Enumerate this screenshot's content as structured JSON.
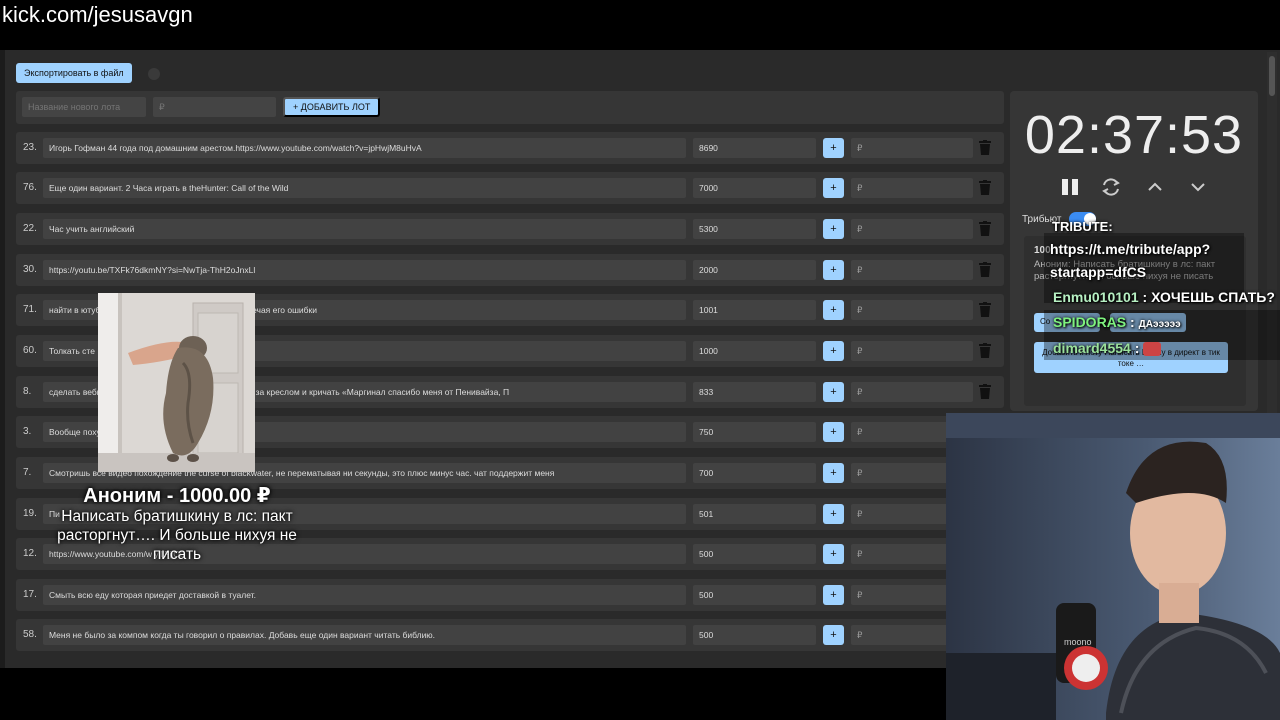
{
  "browser": {
    "url": "kick.com/jesusavgn"
  },
  "toolbar": {
    "export_label": "Экспортировать в файл"
  },
  "add_lot": {
    "name_placeholder": "Название нового лота",
    "amount_placeholder": "₽",
    "add_label": "+ ДОБАВИТЬ ЛОТ"
  },
  "lots": [
    {
      "num": "23.",
      "name": "Игорь Гофман 44 года под домашним арестом.https://www.youtube.com/watch?v=jpHwjM8uHvA",
      "amount": "8690",
      "plus": "+",
      "rub": "₽"
    },
    {
      "num": "76.",
      "name": "Еще один вариант. 2 Часа играть в theHunter: Call of the Wild",
      "amount": "7000",
      "plus": "+",
      "rub": "₽"
    },
    {
      "num": "22.",
      "name": "Час учить английский",
      "amount": "5300",
      "plus": "+",
      "rub": "₽"
    },
    {
      "num": "30.",
      "name": "https://youtu.be/TXFk76dkmNY?si=NwTja-ThH2oJnxLl",
      "amount": "2000",
      "plus": "+",
      "rub": "₽"
    },
    {
      "num": "71.",
      "name": "найти в ютуб                                                               трого в кс и комментировать ее, подмечая его ошибки",
      "amount": "1001",
      "plus": "+",
      "rub": "₽"
    },
    {
      "num": "60.",
      "name": "Толкать сте",
      "amount": "1000",
      "plus": "+",
      "rub": "₽"
    },
    {
      "num": "8.",
      "name": "сделать вебк                                                          ртку Пенивайза. и 60 минут прятаться за креслом и кричать «Маргинал спасибо меня от Пенивайза, П",
      "amount": "833",
      "plus": "+",
      "rub": "₽"
    },
    {
      "num": "3.",
      "name": "Вообще похуй",
      "amount": "750",
      "plus": "+",
      "rub": "₽"
    },
    {
      "num": "7.",
      "name": "Смотришь все видео                                        похождение the curse of blackwater, не перематывая ни секунды, это плюс минус час. чат поддержит меня",
      "amount": "700",
      "plus": "+",
      "rub": "₽"
    },
    {
      "num": "19.",
      "name": "Пи",
      "amount": "501",
      "plus": "+",
      "rub": "₽"
    },
    {
      "num": "12.",
      "name": "https://www.youtube.com/w                                  yillFjjOs",
      "amount": "500",
      "plus": "+",
      "rub": "₽"
    },
    {
      "num": "17.",
      "name": "Смыть всю еду которая приедет доставкой в туалет.",
      "amount": "500",
      "plus": "+",
      "rub": "₽"
    },
    {
      "num": "58.",
      "name": "Меня не было за компом когда ты говорил о правилах. Добавь еще один вариант читать библию.",
      "amount": "500",
      "plus": "+",
      "rub": "₽"
    }
  ],
  "timer": {
    "value": "02:37:53"
  },
  "tribute": {
    "label": "Трибьют",
    "enabled": true
  },
  "donation": {
    "amount": "100",
    "text": "Аноним: Написать братишкину в лс: пакт расторгнут…. И больше нихуя не писать",
    "btn1": "Со",
    "btn2": "ДА",
    "btn3": "Добавить к лоту Написать Шапку в директ в тик токе …"
  },
  "chat": [
    {
      "text": "TRIBUTE:"
    },
    {
      "text": "https://t.me/tribute/app?"
    },
    {
      "text": "startapp=dfCS"
    },
    {
      "user": "Enmu010101",
      "sep": " : ",
      "msg": "ХОЧЕШЬ СПАТЬ?",
      "color": "#b7f0c3"
    },
    {
      "user": "SPIDORAS",
      "sep": " : ",
      "msg": "ДАэээээ",
      "color": "#7ef27e"
    },
    {
      "user": "dimard4554",
      "sep": " : ",
      "msg": "",
      "color": "#9be29b"
    }
  ],
  "alert": {
    "title": "Аноним - 1000.00 ₽",
    "text": "Написать братишкину в лс: пакт расторгнут…. И больше нихуя не писать"
  },
  "colors": {
    "accent": "#9fd2ff",
    "switch": "#3b8cf2",
    "panel": "#363636",
    "bg": "#2a2a2a"
  }
}
